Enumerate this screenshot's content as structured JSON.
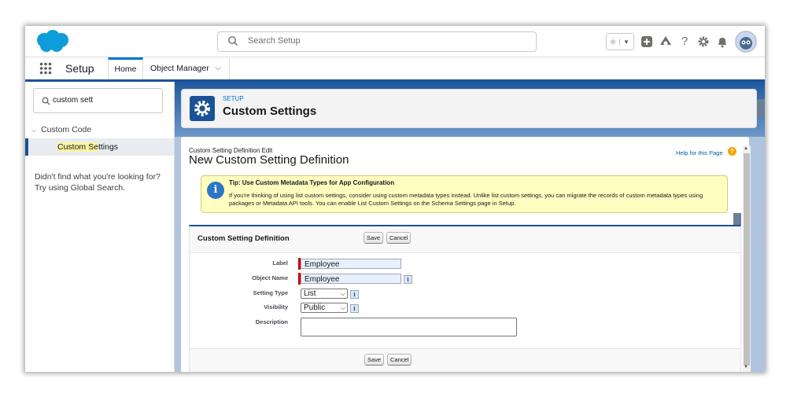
{
  "header": {
    "search_placeholder": "Search Setup",
    "icons": [
      "favorites-star-icon",
      "favorites-dropdown-icon",
      "global-actions-icon",
      "trailhead-icon",
      "help-icon",
      "setup-gear-icon",
      "notifications-bell-icon",
      "user-avatar"
    ]
  },
  "nav": {
    "app_name": "Setup",
    "tabs": [
      {
        "label": "Home",
        "active": true
      },
      {
        "label": "Object Manager"
      }
    ]
  },
  "sidebar": {
    "quick_find_value": "custom sett",
    "category": "Custom Code",
    "item_prefix": "Custom Se",
    "item_highlight": "ttings",
    "not_found_line1": "Didn't find what you're looking for?",
    "not_found_line2": "Try using Global Search."
  },
  "page_header": {
    "kicker": "SETUP",
    "title": "Custom Settings"
  },
  "content": {
    "breadcrumb": "Custom Setting Definition Edit",
    "title": "New Custom Setting Definition",
    "help_link": "Help for this Page",
    "tip": {
      "title": "Tip: Use Custom Metadata Types for App Configuration",
      "body": "If you're thinking of using list custom settings, consider using custom metadata types instead. Unlike list custom settings, you can migrate the records of custom metadata types using packages or Metadata API tools. You can enable List Custom Settings on the Schema Settings page in Setup."
    },
    "section_title": "Custom Setting Definition",
    "save_label": "Save",
    "cancel_label": "Cancel",
    "fields": {
      "label_label": "Label",
      "label_value": "Employee",
      "object_name_label": "Object Name",
      "object_name_value": "Employee",
      "setting_type_label": "Setting Type",
      "setting_type_value": "List",
      "visibility_label": "Visibility",
      "visibility_value": "Public",
      "description_label": "Description"
    }
  },
  "colors": {
    "brand_blue": "#1b5297",
    "link_blue": "#0176d3",
    "tip_background": "#fffdc0",
    "required_red": "#cc0000"
  }
}
